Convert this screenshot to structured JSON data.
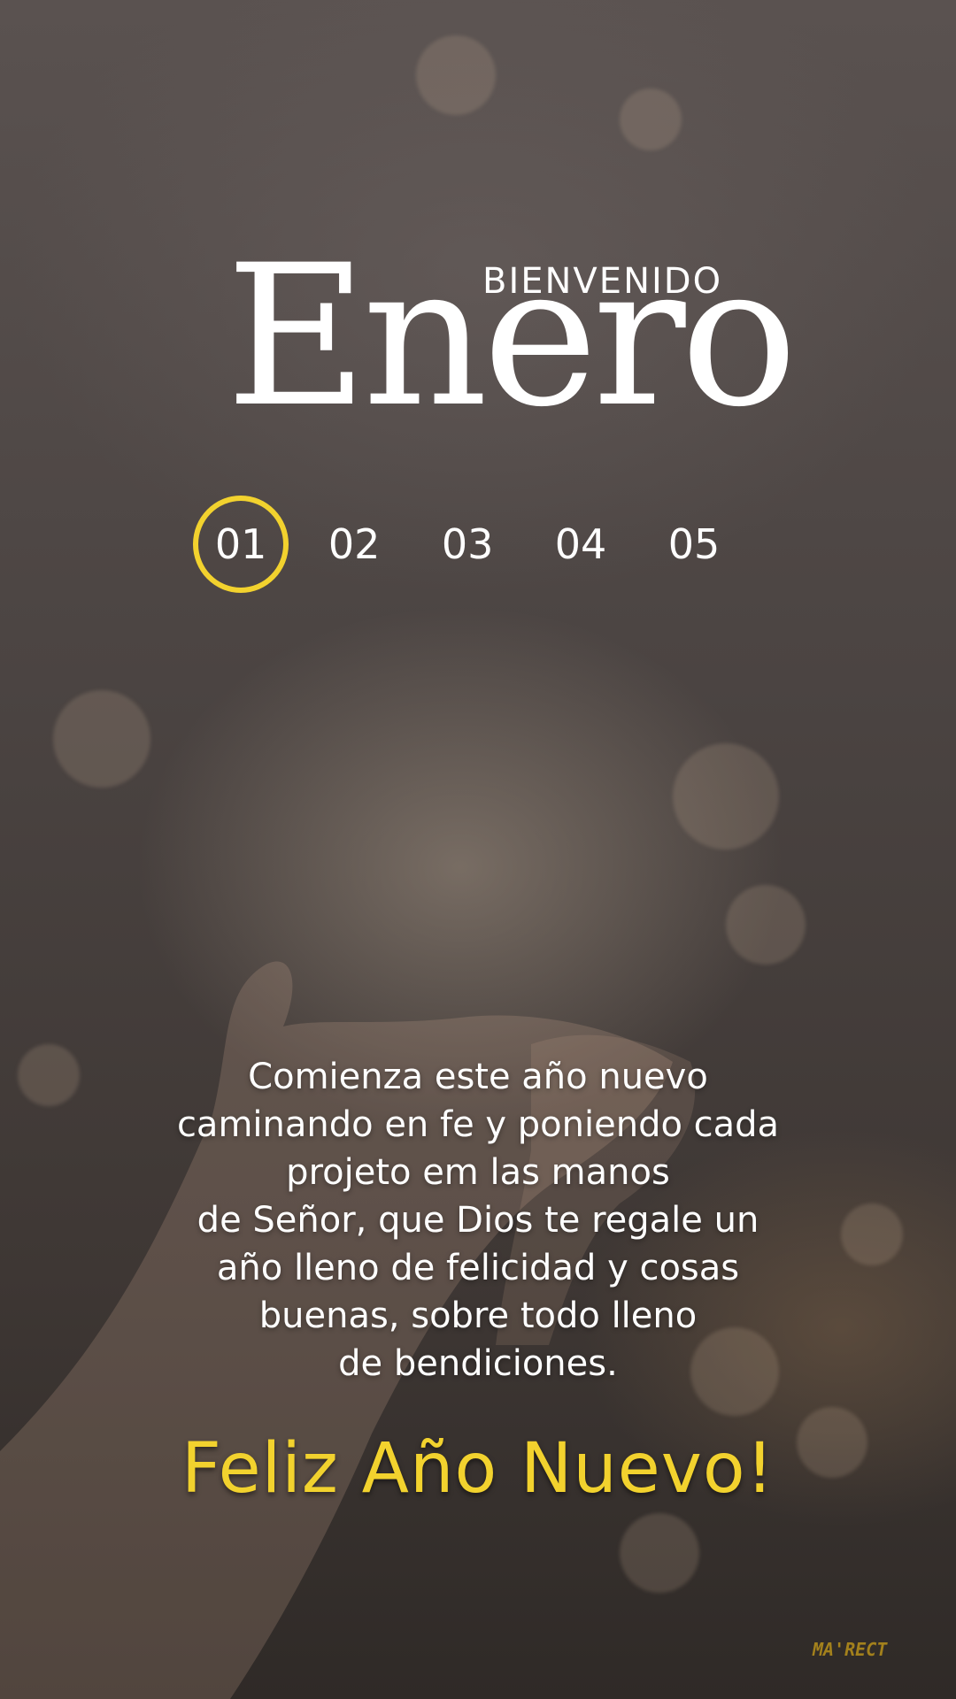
{
  "header": {
    "welcome": "BIENVENIDO",
    "month": "Enero"
  },
  "days": [
    "01",
    "02",
    "03",
    "04",
    "05"
  ],
  "selected_day": "01",
  "message_lines": [
    "Comienza este año nuevo",
    "caminando en fe y poniendo cada",
    "projeto em las manos",
    "de Señor, que Dios te regale un",
    "año lleno de felicidad y cosas",
    "buenas, sobre todo lleno",
    "de bendiciones."
  ],
  "greeting": "Feliz Año Nuevo!",
  "watermark": "MA'RECT",
  "colors": {
    "accent": "#f2d22e",
    "text": "#ffffff",
    "background": "#4a4341"
  }
}
